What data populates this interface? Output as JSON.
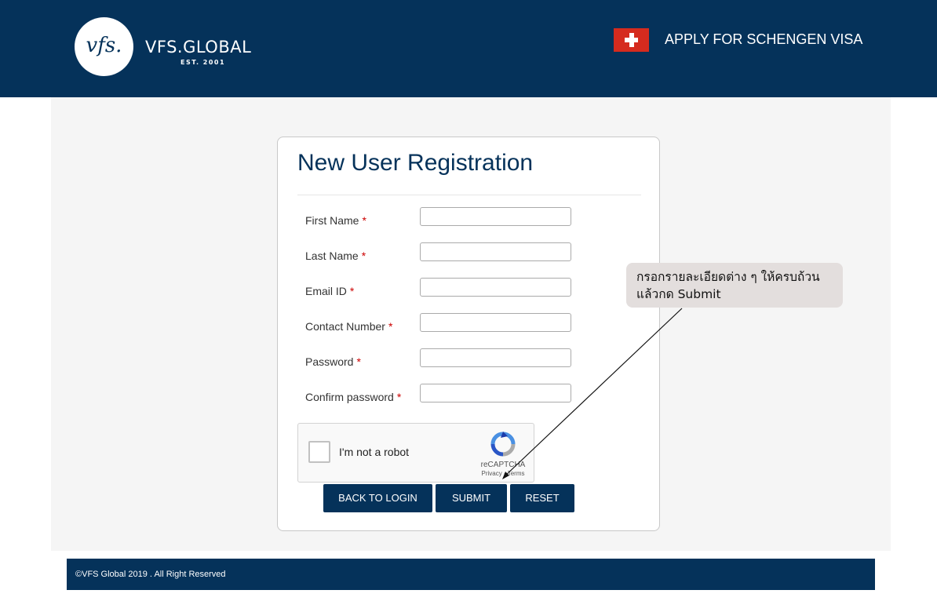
{
  "header": {
    "logo_mark": "vfs.",
    "brand_name": "VFS.GLOBAL",
    "brand_tagline": "EST. 2001",
    "apply_label": "APPLY FOR SCHENGEN VISA",
    "flag_icon": "swiss-flag-icon"
  },
  "form": {
    "title": "New User Registration",
    "required_marker": "*",
    "fields": [
      {
        "label": "First Name",
        "value": ""
      },
      {
        "label": "Last Name",
        "value": ""
      },
      {
        "label": "Email ID",
        "value": ""
      },
      {
        "label": "Contact Number",
        "value": ""
      },
      {
        "label": "Password",
        "value": ""
      },
      {
        "label": "Confirm password",
        "value": ""
      }
    ],
    "captcha": {
      "label": "I'm not a robot",
      "brand": "reCAPTCHA",
      "privacy": "Privacy",
      "separator": " - ",
      "terms": "Terms",
      "checked": false
    },
    "buttons": {
      "back": "BACK TO LOGIN",
      "submit": "SUBMIT",
      "reset": "RESET"
    }
  },
  "callout": {
    "line1": "กรอกรายละเอียดต่าง ๆ ให้ครบถ้วน",
    "line2": "แล้วกด Submit"
  },
  "footer": {
    "copyright": "©VFS Global 2019 . All Right Reserved"
  },
  "colors": {
    "brand_navy": "#05325a",
    "required_red": "#cc0000",
    "flag_red": "#d52b1e"
  }
}
